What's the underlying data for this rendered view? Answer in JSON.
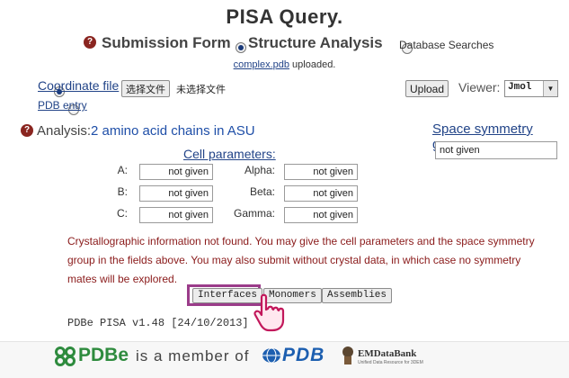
{
  "page": {
    "title": "PISA Query."
  },
  "modes": {
    "submission_form": "Submission Form",
    "structure_analysis": "Structure Analysis",
    "database_searches": "Database Searches"
  },
  "upload_status": {
    "file": "complex.pdb",
    "suffix": " uploaded."
  },
  "input": {
    "coordinate_file_label": "Coordinate file",
    "choose_file_button": "选择文件",
    "no_file_text": "未选择文件",
    "upload_button": "Upload",
    "viewer_label": "Viewer:",
    "viewer_value": "Jmol",
    "pdb_entry_label": "PDB entry"
  },
  "analysis": {
    "label": "Analysis:",
    "value": "2 amino acid chains in ASU",
    "space_group_label": "Space symmetry group:",
    "space_group_value": "not given"
  },
  "cell_parameters": {
    "title": "Cell parameters:",
    "a_label": "A:",
    "a_value": "not given",
    "b_label": "B:",
    "b_value": "not given",
    "c_label": "C:",
    "c_value": "not given",
    "alpha_label": "Alpha:",
    "alpha_value": "not given",
    "beta_label": "Beta:",
    "beta_value": "not given",
    "gamma_label": "Gamma:",
    "gamma_value": "not given"
  },
  "warning": {
    "line1": "Crystallographic information not found. You may give the cell parameters and the space symmetry",
    "line2": "group in the fields above. You may also submit without crystal data, in which case no symmetry",
    "line3": "mates will be explored."
  },
  "actions": {
    "interfaces": "Interfaces",
    "monomers": "Monomers",
    "assemblies": "Assemblies"
  },
  "version": "PDBe PISA v1.48 [24/10/2013]",
  "footer": {
    "pdbe": "PDBe",
    "member_text": "is a member of",
    "pdb": "PDB",
    "emdatabank": "EMDataBank",
    "emdatabank_sub": "Unified Data Resource for 3DEM"
  },
  "colors": {
    "link": "#224488",
    "warning": "#8a1a1a",
    "highlight": "#9b3c8a",
    "pdb_blue": "#1d5fb0",
    "pdbe_green": "#2e8b3e"
  }
}
